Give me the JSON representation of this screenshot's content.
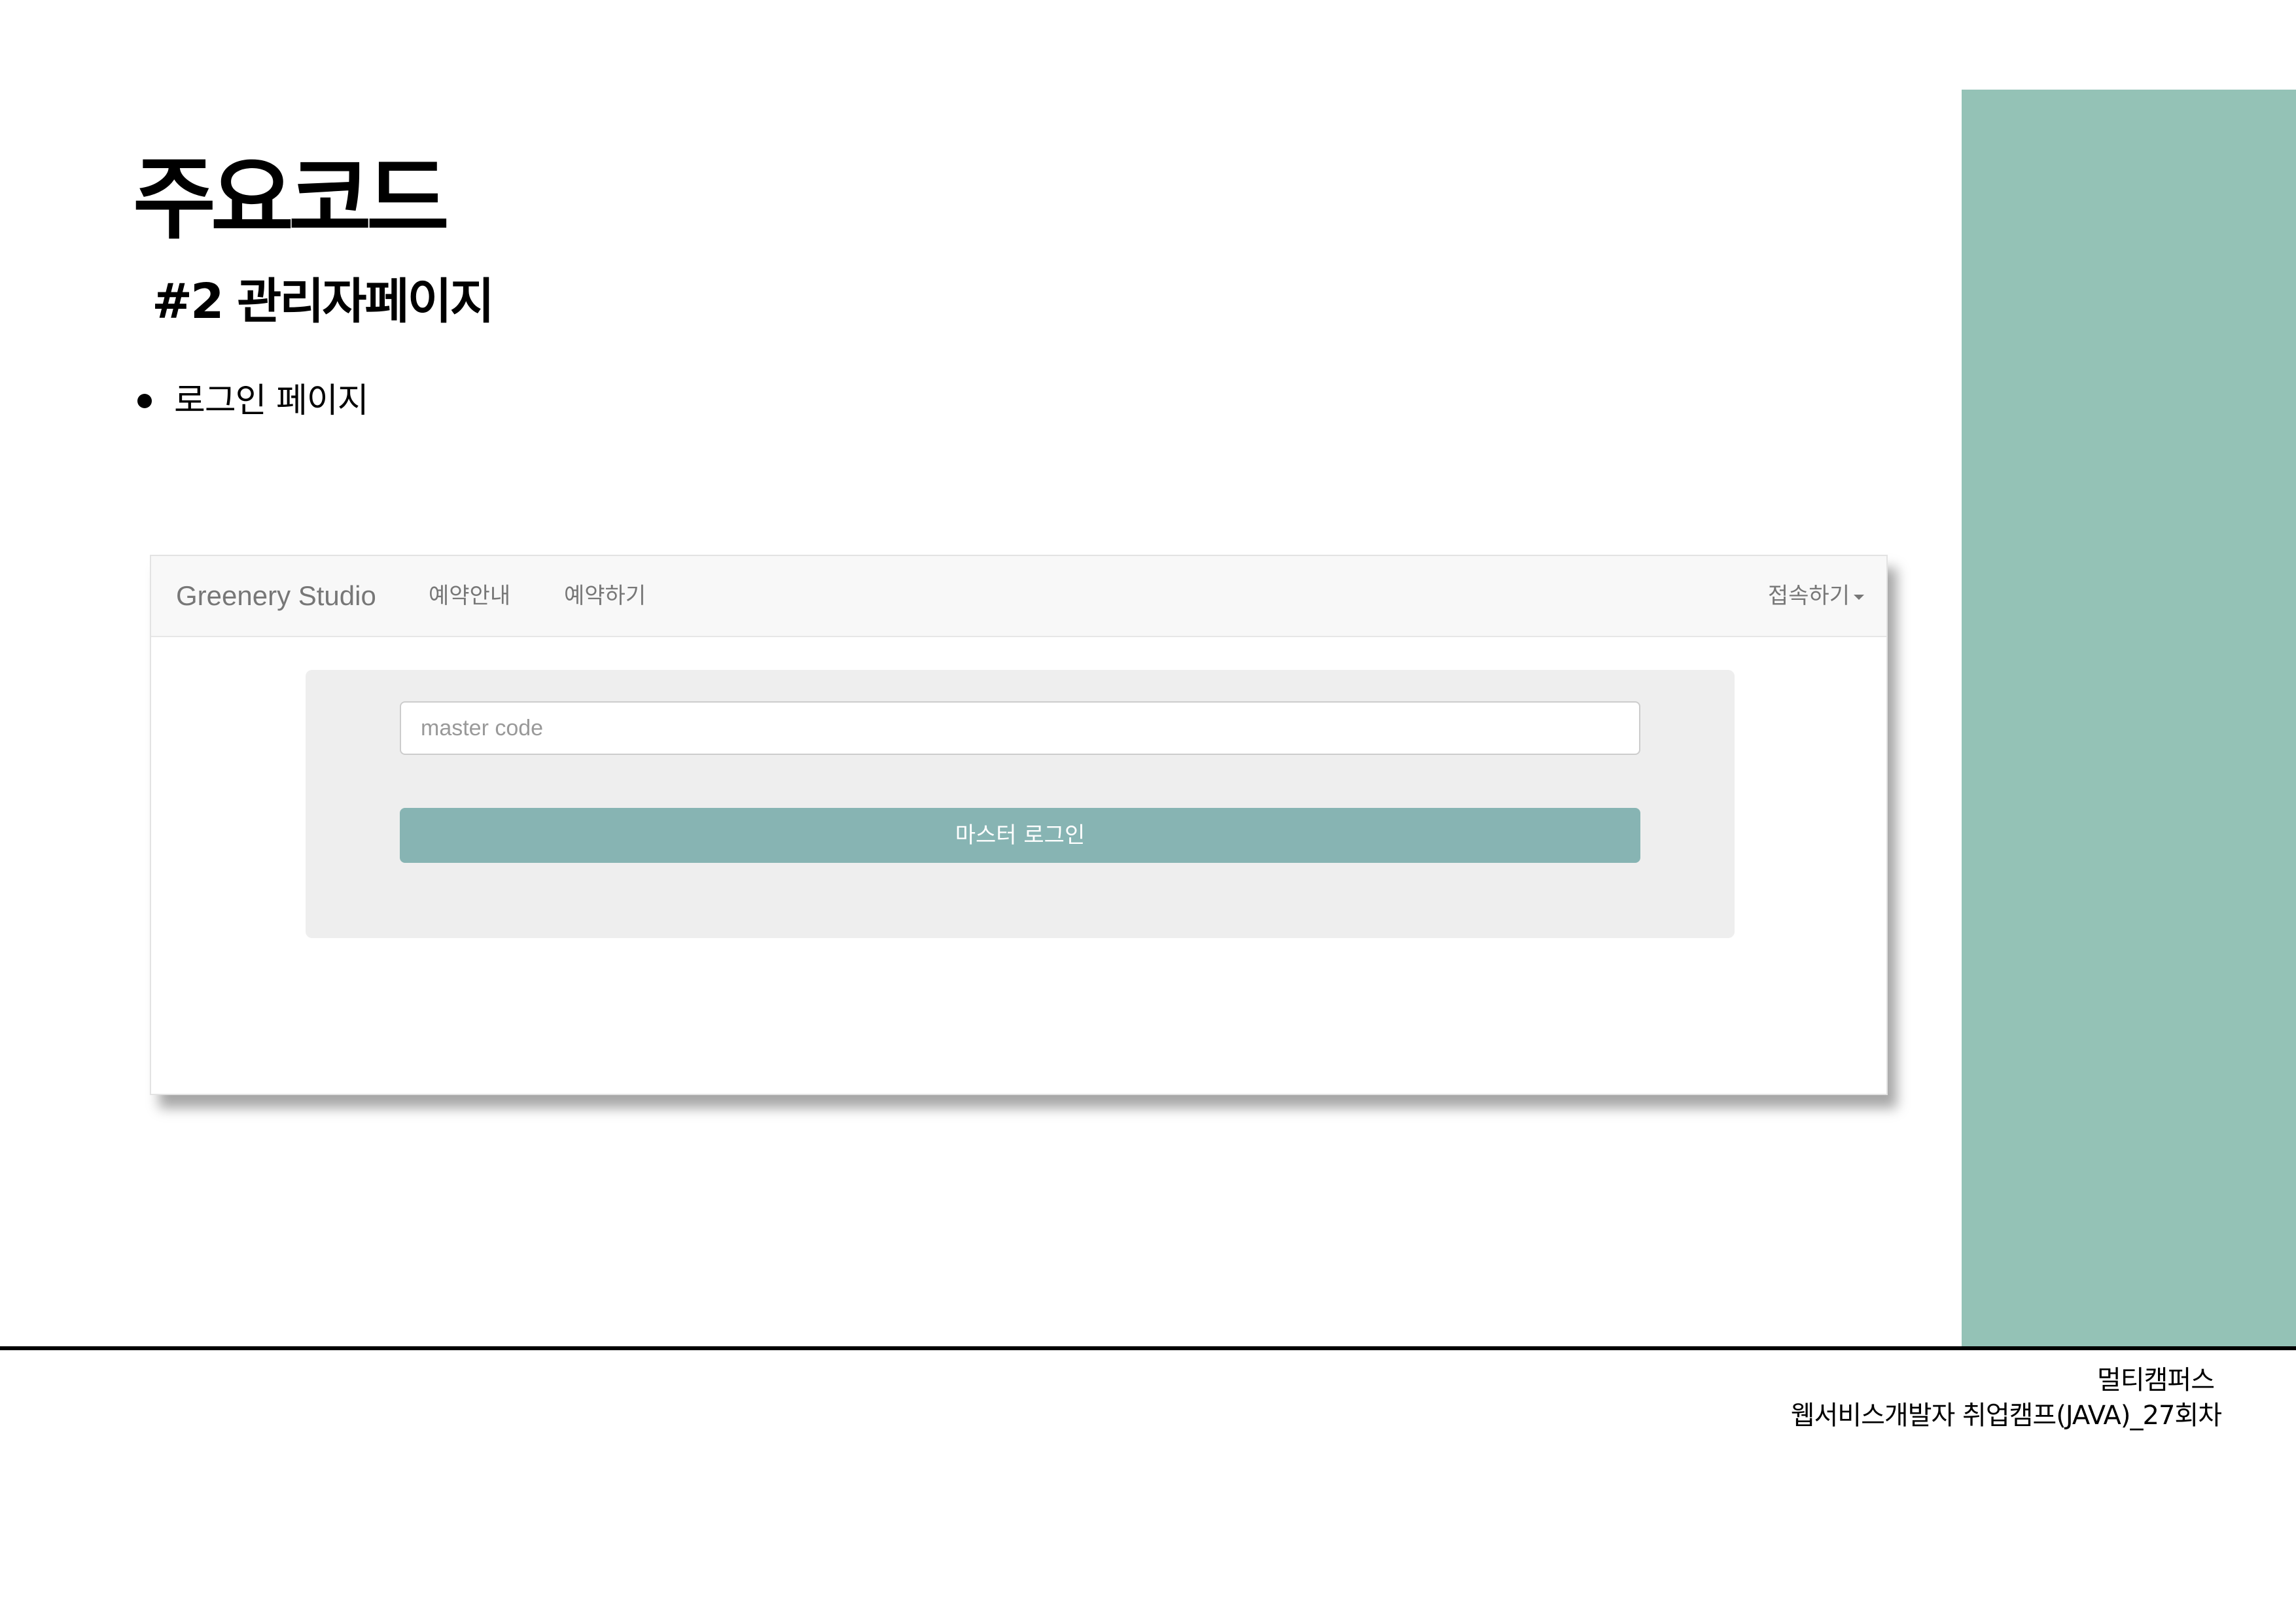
{
  "slide": {
    "title": "주요코드",
    "subtitle": "#2 관리자페이지",
    "bullet": "로그인 페이지"
  },
  "browser": {
    "navbar": {
      "brand": "Greenery Studio",
      "links": [
        "예약안내",
        "예약하기"
      ],
      "dropdown_label": "접속하기"
    },
    "login_form": {
      "input_placeholder": "master code",
      "input_value": "",
      "button_label": "마스터 로그인"
    }
  },
  "footer": {
    "organization": "멀티캠퍼스",
    "course": "웹서비스개발자 취업캠프(JAVA)_27회차"
  },
  "colors": {
    "side_panel": "#94c2b6",
    "login_button": "#87b4b3",
    "navbar_bg": "#f8f8f8",
    "well_bg": "#eeeeee"
  }
}
